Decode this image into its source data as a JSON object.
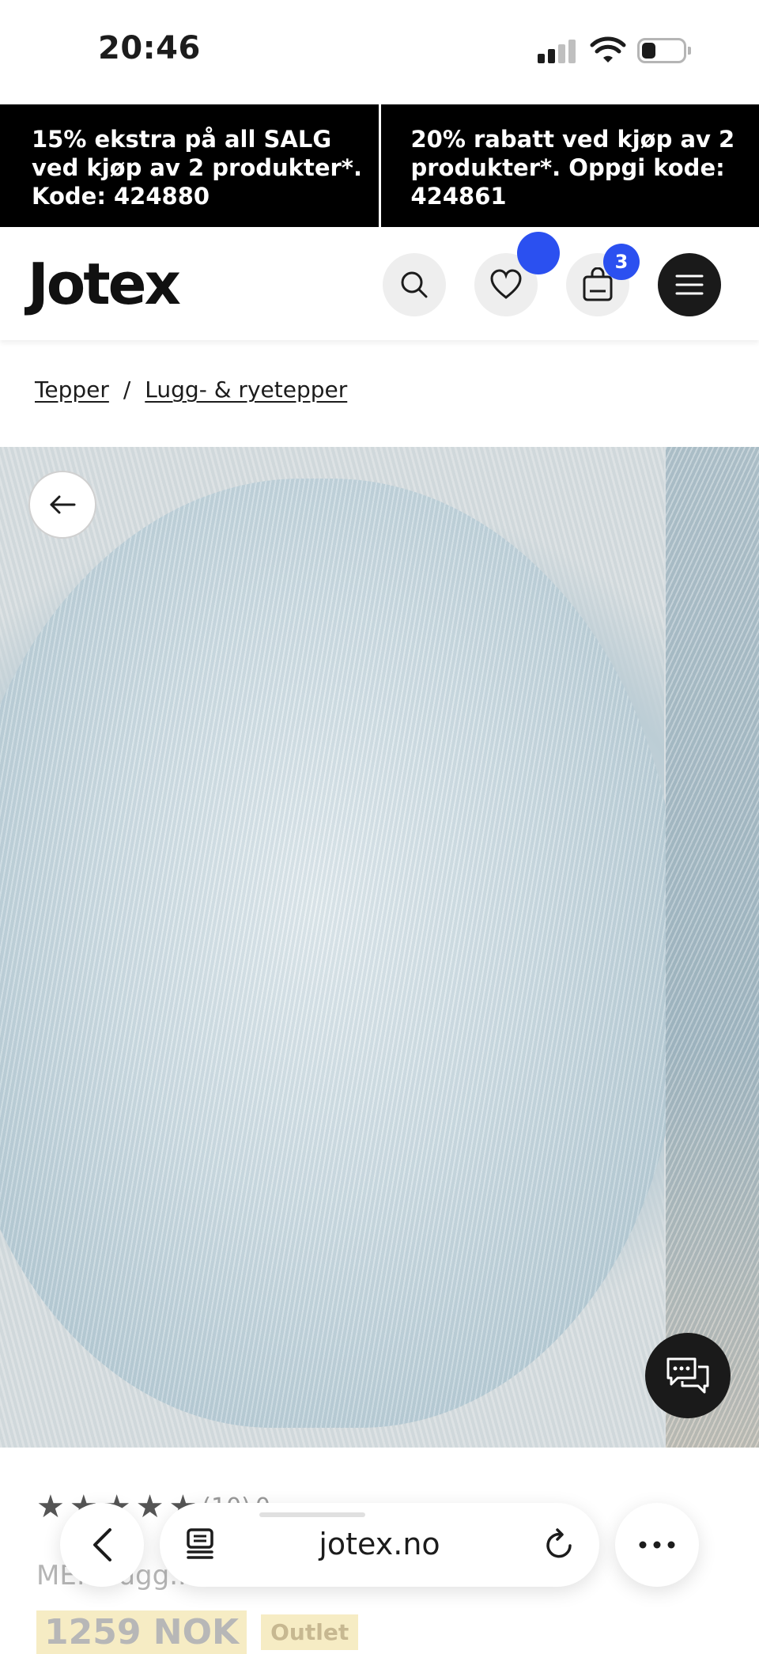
{
  "status_bar": {
    "time": "20:46"
  },
  "promos": [
    {
      "text": "15% ekstra på all SALG ved kjøp av 2 produkter*. Kode: 424880"
    },
    {
      "text": "20% rabatt ved kjøp av 2 produkter*. Oppgi kode: 424861"
    }
  ],
  "header": {
    "logo": "Jotex",
    "cart_count": "3",
    "icons": [
      "search-icon",
      "heart-icon",
      "bag-icon",
      "menu-icon"
    ],
    "accent_color": "#2b50f0"
  },
  "breadcrumb": [
    {
      "label": "Tepper"
    },
    {
      "label": "Lugg- & ryetepper"
    }
  ],
  "breadcrumb_separator": "/",
  "product": {
    "rating_count": "(10)",
    "rating_extra": "0 ...",
    "title": "ME... lugg... ...",
    "price": "1259 NOK",
    "badge": "Outlet"
  },
  "browser": {
    "url": "jotex.no"
  }
}
